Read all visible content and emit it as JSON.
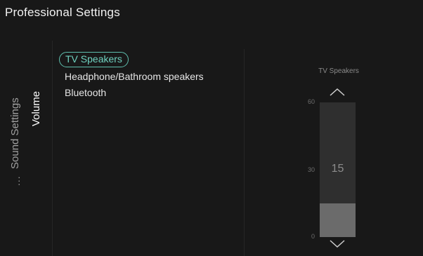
{
  "header": {
    "title": "Professional Settings"
  },
  "breadcrumb": {
    "more": "...",
    "parent": "Sound Settings",
    "current": "Volume"
  },
  "menu": {
    "items": [
      {
        "label": "TV Speakers",
        "selected": true
      },
      {
        "label": "Headphone/Bathroom speakers",
        "selected": false
      },
      {
        "label": "Bluetooth",
        "selected": false
      }
    ]
  },
  "slider": {
    "title": "TV Speakers",
    "max_label": "60",
    "mid_label": "30",
    "min_label": "0",
    "value": "15",
    "min": 0,
    "max": 60,
    "current": 15
  },
  "colors": {
    "background": "#181818",
    "accent": "#6fd1bf",
    "track": "#2f2f2f",
    "fill": "#6b6b6b"
  },
  "icons": {
    "up": "chevron-up-icon",
    "down": "chevron-down-icon"
  }
}
